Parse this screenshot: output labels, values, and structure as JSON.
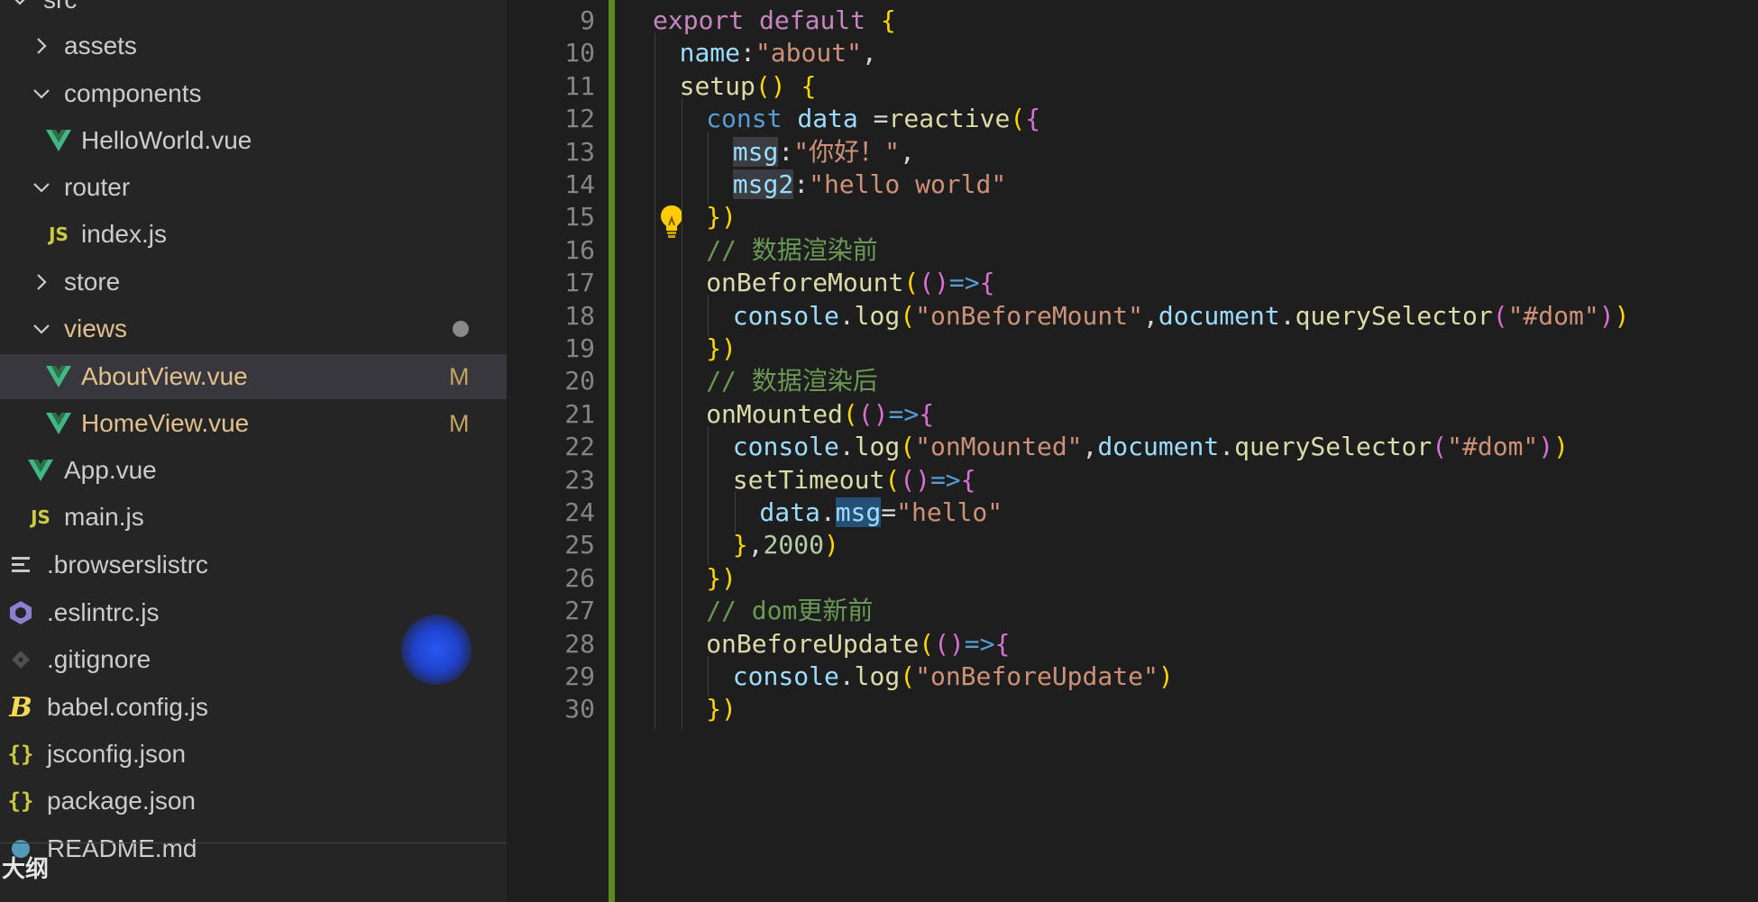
{
  "sidebar": {
    "items": [
      {
        "label": "src",
        "kind": "folder-open",
        "indent": 0
      },
      {
        "label": "assets",
        "kind": "folder-closed",
        "indent": 1
      },
      {
        "label": "components",
        "kind": "folder-open",
        "indent": 1
      },
      {
        "label": "HelloWorld.vue",
        "kind": "vue",
        "indent": 2
      },
      {
        "label": "router",
        "kind": "folder-open",
        "indent": 1
      },
      {
        "label": "index.js",
        "kind": "js",
        "indent": 2
      },
      {
        "label": "store",
        "kind": "folder-closed",
        "indent": 1
      },
      {
        "label": "views",
        "kind": "folder-open",
        "indent": 1
      },
      {
        "label": "AboutView.vue",
        "kind": "vue",
        "indent": 2,
        "badge": "M"
      },
      {
        "label": "HomeView.vue",
        "kind": "vue",
        "indent": 2,
        "badge": "M"
      },
      {
        "label": "App.vue",
        "kind": "vue",
        "indent": 1
      },
      {
        "label": "main.js",
        "kind": "js",
        "indent": 1
      },
      {
        "label": ".browserslistrc",
        "kind": "lines",
        "indent": 0
      },
      {
        "label": ".eslintrc.js",
        "kind": "eslint",
        "indent": 0
      },
      {
        "label": ".gitignore",
        "kind": "git",
        "indent": 0
      },
      {
        "label": "babel.config.js",
        "kind": "babel",
        "indent": 0
      },
      {
        "label": "jsconfig.json",
        "kind": "json",
        "indent": 0
      },
      {
        "label": "package.json",
        "kind": "json",
        "indent": 0
      },
      {
        "label": "README.md",
        "kind": "info",
        "indent": 0
      }
    ],
    "icons": {
      "js": "JS",
      "json": "{}",
      "babel": "B"
    },
    "outline_title": "大纲"
  },
  "editor": {
    "lines": [
      {
        "n": "9",
        "text": "export default {"
      },
      {
        "n": "10",
        "text": "name:\"about\","
      },
      {
        "n": "11",
        "text": "setup() {"
      },
      {
        "n": "12",
        "text": "const data =reactive({"
      },
      {
        "n": "13",
        "text": "msg:\"你好！\","
      },
      {
        "n": "14",
        "text": "msg2:\"hello world\""
      },
      {
        "n": "15",
        "text": "})"
      },
      {
        "n": "16",
        "text": "// 数据渲染前"
      },
      {
        "n": "17",
        "text": "onBeforeMount(()=>{"
      },
      {
        "n": "18",
        "text": "console.log(\"onBeforeMount\",document.querySelector(\"#dom\"))"
      },
      {
        "n": "19",
        "text": "})"
      },
      {
        "n": "20",
        "text": "// 数据渲染后"
      },
      {
        "n": "21",
        "text": "onMounted(()=>{"
      },
      {
        "n": "22",
        "text": "console.log(\"onMounted\",document.querySelector(\"#dom\"))"
      },
      {
        "n": "23",
        "text": "setTimeout(()=>{"
      },
      {
        "n": "24",
        "text": "data.msg=\"hello\""
      },
      {
        "n": "25",
        "text": "},2000)"
      },
      {
        "n": "26",
        "text": "})"
      },
      {
        "n": "27",
        "text": "// dom更新前"
      },
      {
        "n": "28",
        "text": "onBeforeUpdate(()=>{"
      },
      {
        "n": "29",
        "text": "console.log(\"onBeforeUpdate\")"
      },
      {
        "n": "30",
        "text": "})"
      }
    ]
  },
  "colors": {
    "sidebar_bg": "#252526",
    "editor_bg": "#1e1e1e",
    "selection_bg": "#37373d",
    "modified": "#e2c08d",
    "vue_green": "#41b883",
    "git_gutter": "#5a8a1e",
    "cursor_highlight": "#2050ff"
  }
}
